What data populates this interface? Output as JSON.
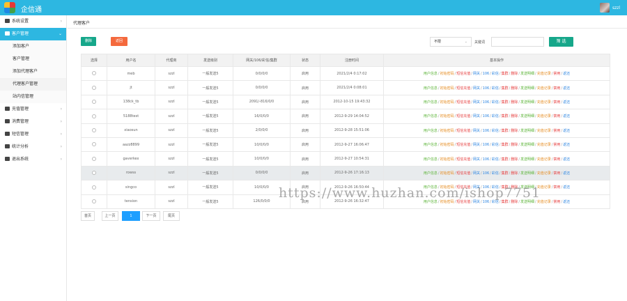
{
  "app": {
    "title": "企信通",
    "user": "szzl"
  },
  "sidebar": {
    "items": [
      {
        "label": "系统设置",
        "icon": "windows-icon",
        "active": false
      },
      {
        "label": "客户管理",
        "icon": "user-icon",
        "active": true
      },
      {
        "label": "充值管理",
        "icon": "card-icon",
        "active": false
      },
      {
        "label": "消费管理",
        "icon": "card-icon",
        "active": false
      },
      {
        "label": "短信管理",
        "icon": "mail-icon",
        "active": false
      },
      {
        "label": "统计分析",
        "icon": "chart-icon",
        "active": false
      },
      {
        "label": "退出系统",
        "icon": "monitor-icon",
        "active": false
      }
    ],
    "submenu": [
      "添加客户",
      "客户管理",
      "添加代理客户",
      "代理客户管理",
      "站内信管理"
    ]
  },
  "breadcrumb": "代理客户",
  "toolbar": {
    "delete_label": "删除",
    "back_label": "返回",
    "select_value": "不限",
    "keyword_label": "关键词",
    "keyword_value": "",
    "filter_label": "筛 选"
  },
  "table": {
    "headers": [
      "选择",
      "用户名",
      "代理商",
      "发送级别",
      "网关/106/彩信/集群",
      "状态",
      "注册时间",
      "基本操作"
    ],
    "rows": [
      {
        "user": "meb",
        "agent": "szzl",
        "level": "一般发送5",
        "gateway": "0/0/0/0",
        "status": "启用",
        "time": "2021/2/4 0:17:02"
      },
      {
        "user": "jt",
        "agent": "szzl",
        "level": "一般发送5",
        "gateway": "0/0/0/0",
        "status": "启用",
        "time": "2021/2/4 0:08:01"
      },
      {
        "user": "138ck_tb",
        "agent": "szzl",
        "level": "一般发送5",
        "gateway": "2091/-816/0/0",
        "status": "启用",
        "time": "2012-10-15 19:43:32"
      },
      {
        "user": "5188test",
        "agent": "szzl",
        "level": "一般发送5",
        "gateway": "16/0/0/0",
        "status": "启用",
        "time": "2012-9-29 14:04:52"
      },
      {
        "user": "xiaosun",
        "agent": "szzl",
        "level": "一般发送5",
        "gateway": "2/0/0/0",
        "status": "启用",
        "time": "2012-9-28 15:51:06"
      },
      {
        "user": "aazz8899",
        "agent": "szzl",
        "level": "一般发送5",
        "gateway": "10/0/0/0",
        "status": "启用",
        "time": "2012-9-27 16:06:47"
      },
      {
        "user": "gaverkex",
        "agent": "szzl",
        "level": "一般发送5",
        "gateway": "10/0/0/0",
        "status": "启用",
        "time": "2012-9-27 10:54:31"
      },
      {
        "user": "rowss",
        "agent": "szzl",
        "level": "一般发送5",
        "gateway": "0/0/0/0",
        "status": "启用",
        "time": "2012-9-26 17:16:13"
      },
      {
        "user": "singco",
        "agent": "szzl",
        "level": "一般发送5",
        "gateway": "10/0/0/0",
        "status": "启用",
        "time": "2012-9-26 16:50:44"
      },
      {
        "user": "tension",
        "agent": "szzl",
        "level": "一般发送5",
        "gateway": "126/0/0/0",
        "status": "启用",
        "time": "2012-9-26 16:32:47"
      }
    ],
    "highlighted_row": 7,
    "actions": [
      {
        "label": "用户信息",
        "color": "#5ab336"
      },
      {
        "label": "初始密码",
        "color": "#e58b1f"
      },
      {
        "label": "短信充值",
        "color": "#e53d3d"
      },
      {
        "label": "网关",
        "color": "#2b84e0"
      },
      {
        "label": "106",
        "color": "#2b84e0"
      },
      {
        "label": "彩信",
        "color": "#2b84e0"
      },
      {
        "label": "集群",
        "color": "#e53d3d"
      },
      {
        "label": "删除",
        "color": "#e53d3d"
      },
      {
        "label": "发送明细",
        "color": "#5ab336"
      },
      {
        "label": "充值记录",
        "color": "#e58b1f"
      },
      {
        "label": "禁用",
        "color": "#e53d3d"
      },
      {
        "label": "返还",
        "color": "#2b84e0"
      }
    ],
    "action_separator": "/"
  },
  "pager": {
    "first": "首页",
    "prev": "上一页",
    "current": "1",
    "next": "下一页",
    "last": "尾页"
  },
  "watermark": "https://www.huzhan.com/ishop7751",
  "colors": {
    "topbar": "#2db7e1",
    "green": "#16a78a",
    "orange": "#f4693d",
    "status": "#e63cde",
    "page_current": "#1e9fff"
  }
}
